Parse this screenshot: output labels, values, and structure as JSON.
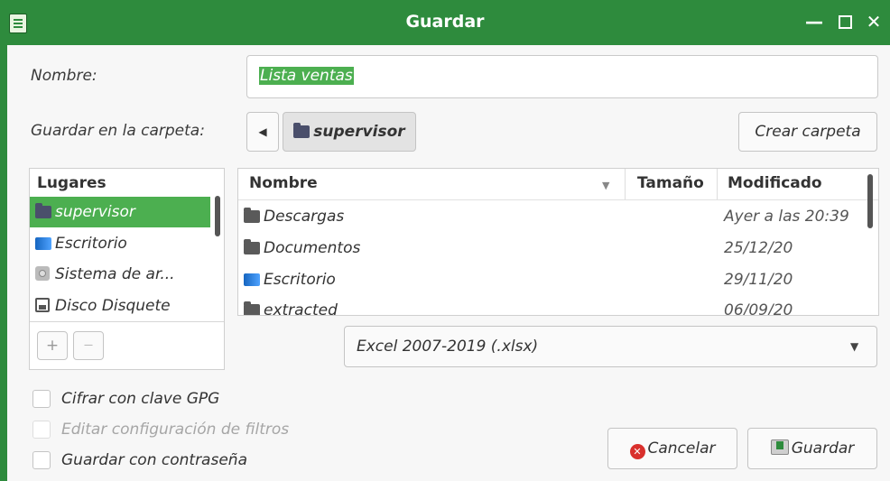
{
  "window": {
    "title": "Guardar"
  },
  "name_field": {
    "label": "Nombre:",
    "value": "Lista ventas"
  },
  "folder_path": {
    "label": "Guardar en la carpeta:",
    "current": "supervisor",
    "create_button": "Crear carpeta"
  },
  "places": {
    "header": "Lugares",
    "items": [
      {
        "label": "supervisor",
        "icon": "folder-icon"
      },
      {
        "label": "Escritorio",
        "icon": "desktop-folder-icon"
      },
      {
        "label": "Sistema de ar...",
        "icon": "disk-icon"
      },
      {
        "label": "Disco Disquete",
        "icon": "floppy-icon"
      }
    ],
    "add_label": "+",
    "remove_label": "—"
  },
  "files": {
    "columns": {
      "name": "Nombre",
      "size": "Tamaño",
      "modified": "Modificado"
    },
    "rows": [
      {
        "name": "Descargas",
        "icon": "folder-icon",
        "modified": "Ayer a las 20:39"
      },
      {
        "name": "Documentos",
        "icon": "folder-icon",
        "modified": "25/12/20"
      },
      {
        "name": "Escritorio",
        "icon": "desktop-folder-icon",
        "modified": "29/11/20"
      },
      {
        "name": "extracted",
        "icon": "folder-icon",
        "modified": "06/09/20"
      }
    ]
  },
  "filter": {
    "value": "Excel 2007-2019 (.xlsx)"
  },
  "options": {
    "encrypt_gpg": "Cifrar con clave GPG",
    "edit_filter": "Editar configuración de filtros",
    "save_password": "Guardar con contraseña"
  },
  "buttons": {
    "cancel": "Cancelar",
    "save": "Guardar"
  },
  "colors": {
    "accent": "#2e8b3d",
    "selection": "#4caf50"
  }
}
